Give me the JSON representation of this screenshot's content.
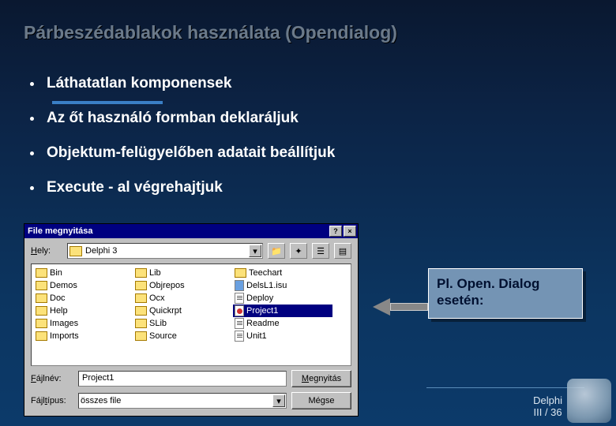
{
  "slide": {
    "title": "Párbeszédablakok használata (Opendialog)",
    "bullets": [
      "Láthatatlan komponensek",
      "Az őt használó formban deklaráljuk",
      "Objektum-felügyelőben adatait beállítjuk",
      "Execute - al végrehajtjuk"
    ]
  },
  "dialog": {
    "title": "File megnyitása",
    "help_btn": "?",
    "close_btn": "×",
    "look_in_label": "Hely:",
    "look_in_value": "Delphi 3",
    "columns": [
      [
        {
          "type": "folder",
          "name": "Bin"
        },
        {
          "type": "folder",
          "name": "Demos"
        },
        {
          "type": "folder",
          "name": "Doc"
        },
        {
          "type": "folder",
          "name": "Help"
        },
        {
          "type": "folder",
          "name": "Images"
        },
        {
          "type": "folder",
          "name": "Imports"
        }
      ],
      [
        {
          "type": "folder",
          "name": "Lib"
        },
        {
          "type": "folder",
          "name": "Objrepos"
        },
        {
          "type": "folder",
          "name": "Ocx"
        },
        {
          "type": "folder",
          "name": "Quickrpt"
        },
        {
          "type": "folder",
          "name": "SLib"
        },
        {
          "type": "folder",
          "name": "Source"
        }
      ],
      [
        {
          "type": "folder",
          "name": "Teechart"
        },
        {
          "type": "file-blue",
          "name": "DelsL1.isu"
        },
        {
          "type": "file-text",
          "name": "Deploy"
        },
        {
          "type": "file-red",
          "name": "Project1"
        },
        {
          "type": "file-text",
          "name": "Readme"
        },
        {
          "type": "file-text",
          "name": "Unit1"
        }
      ]
    ],
    "filename_label": "Fájlnév:",
    "filename_value": "Project1",
    "filetype_label": "Fájltípus:",
    "filetype_value": "összes file",
    "open_btn": "Megnyitás",
    "cancel_btn": "Mégse"
  },
  "callout": {
    "line1": "Pl.  Open. Dialog",
    "line2": " esetén:"
  },
  "footer": {
    "line1": "Delphi",
    "line2": "III / 36"
  }
}
